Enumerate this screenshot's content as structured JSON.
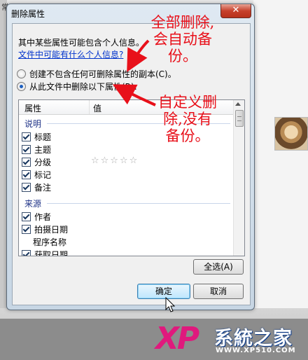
{
  "window": {
    "title": "删除属性",
    "close_label": "✕"
  },
  "background": {
    "top_text": "常"
  },
  "dialog": {
    "info_text": "其中某些属性可能包含个人信息。",
    "info_link": "文件中可能有什么个人信息?",
    "option_copy": "创建不包含任何可删除属性的副本(C)。",
    "option_remove": "从此文件中删除以下属性(R):",
    "selected_option": "option_remove"
  },
  "list": {
    "columns": [
      "属性",
      "值"
    ],
    "groups": [
      {
        "name": "说明",
        "rows": [
          {
            "label": "标题",
            "checked": true
          },
          {
            "label": "主题",
            "checked": true
          },
          {
            "label": "分级",
            "checked": true,
            "value_stars": "☆☆☆☆☆"
          },
          {
            "label": "标记",
            "checked": true
          },
          {
            "label": "备注",
            "checked": true
          }
        ]
      },
      {
        "name": "来源",
        "rows": [
          {
            "label": "作者",
            "checked": true
          },
          {
            "label": "拍摄日期",
            "checked": true
          },
          {
            "label": "程序名称",
            "checked": false,
            "has_checkbox": false
          },
          {
            "label": "获取日期",
            "checked": true
          }
        ]
      }
    ]
  },
  "buttons": {
    "select_all": "全选(A)",
    "ok": "确定",
    "cancel": "取消"
  },
  "annotations": {
    "top_note": [
      "全部删除,",
      "会自动备",
      "份。"
    ],
    "bottom_note": [
      "自定义删",
      "除,没有",
      "备份。"
    ],
    "color": "#e8101a"
  },
  "logo": {
    "xp": "XP",
    "cn": "系統之家",
    "url": "WWW.XP510.COM"
  }
}
